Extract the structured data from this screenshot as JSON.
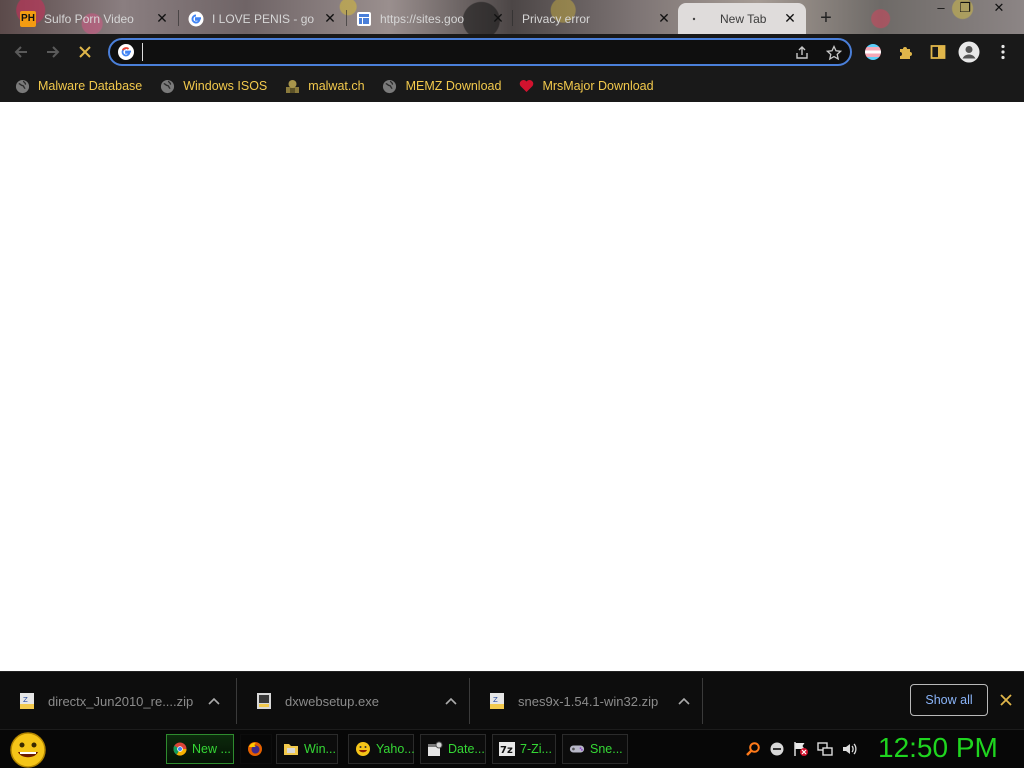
{
  "tabs": [
    {
      "title": "Sulfo Porn Video",
      "favicon": "PH",
      "active": false
    },
    {
      "title": "I LOVE PENIS - go",
      "favicon": "google-icon",
      "active": false
    },
    {
      "title": "https://sites.goo",
      "favicon": "sites-icon",
      "active": false
    },
    {
      "title": "Privacy error",
      "favicon": "",
      "active": false
    },
    {
      "title": "New Tab",
      "favicon": "",
      "active": true
    }
  ],
  "window_controls": {
    "minimize": "–",
    "maximize": "❐",
    "close": "✕"
  },
  "toolbar": {
    "back_icon": "arrow-left-icon",
    "forward_icon": "arrow-right-icon",
    "stop_icon": "x-stop-icon"
  },
  "omnibox": {
    "value": "",
    "placeholder": ""
  },
  "bookmarks": [
    {
      "label": "Malware Database",
      "icon": "globe-icon"
    },
    {
      "label": "Windows ISOS",
      "icon": "globe-icon"
    },
    {
      "label": "malwat.ch",
      "icon": "malwatch-icon"
    },
    {
      "label": "MEMZ Download",
      "icon": "globe-icon"
    },
    {
      "label": "MrsMajor Download",
      "icon": "heart-icon"
    }
  ],
  "downloads": [
    {
      "name": "directx_Jun2010_re....zip"
    },
    {
      "name": "dxwebsetup.exe"
    },
    {
      "name": "snes9x-1.54.1-win32.zip"
    }
  ],
  "shelf": {
    "show_all": "Show all"
  },
  "taskbar": {
    "items": [
      {
        "label": "New ...",
        "icon": "chrome-icon",
        "active": true
      },
      {
        "label": "",
        "icon": "firefox-icon",
        "active": false
      },
      {
        "label": "Win...",
        "icon": "folder-icon",
        "active": false
      },
      {
        "label": "Yaho...",
        "icon": "yahoo-smiley-icon",
        "active": false
      },
      {
        "label": "Date...",
        "icon": "date-icon",
        "active": false
      },
      {
        "label": "7-Zi...",
        "icon": "7zip-icon",
        "active": false
      },
      {
        "label": "Sne...",
        "icon": "snes-icon",
        "active": false
      }
    ],
    "clock": "12:50 PM"
  },
  "colors": {
    "bookmark_text": "#f2c94c",
    "taskbar_text": "#35d835",
    "clock": "#1fd51f",
    "omnibox_border": "#4a7fd9"
  }
}
